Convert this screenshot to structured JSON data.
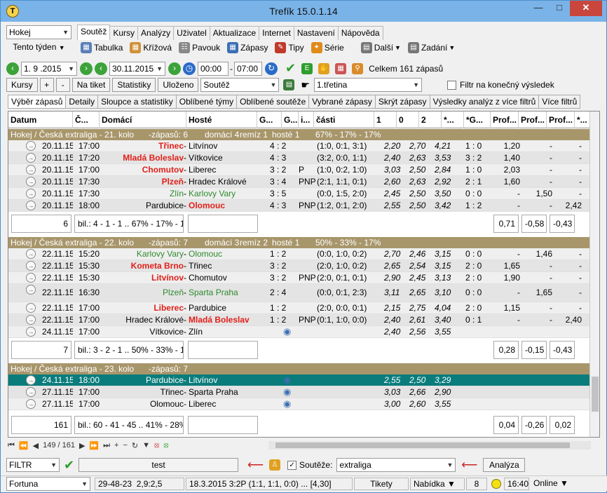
{
  "window": {
    "title": "Trefík 15.0.1.14"
  },
  "toolbar1": {
    "sport": "Hokej",
    "period": "Tento týden",
    "tabs": [
      "Soutěž",
      "Kursy",
      "Analýzy",
      "Uživatel",
      "Aktualizace",
      "Internet",
      "Nastavení",
      "Nápověda"
    ],
    "tools": [
      "Tabulka",
      "Křížová",
      "Pavouk",
      "Zápasy",
      "Tipy",
      "Série",
      "Další",
      "Zadání"
    ]
  },
  "toolbar2": {
    "date_from": "1. 9 .2015",
    "date_to": "30.11.2015",
    "time_from": "00:00",
    "time_to": "07:00",
    "total": "Celkem 161 zápasů"
  },
  "toolbar3": {
    "buttons": [
      "Kursy",
      "+",
      "-",
      "Na tiket",
      "Statistiky",
      "Uloženo"
    ],
    "filter_combo": "Soutěž",
    "period_combo": "1.třetina",
    "final_filter": "Filtr na konečný výsledek"
  },
  "subtabs": [
    "Výběr zápasů",
    "Detaily",
    "Sloupce a statistiky",
    "Oblíbené týmy",
    "Oblíbené soutěže",
    "Vybrané zápasy",
    "Skrýt zápasy",
    "Výsledky analýz z více filtrů",
    "Více filtrů"
  ],
  "columns": [
    "Datum",
    "Č...",
    "Domácí",
    "Hosté",
    "G...",
    "G...",
    "i...",
    "části",
    "1",
    "0",
    "2",
    "*...",
    "*G...",
    "Prof...",
    "Prof...",
    "Prof...",
    "*..."
  ],
  "groups": [
    {
      "title": "Hokej / Česká extraliga - 21. kolo",
      "count": "-zápasů: 6",
      "home": "domácí 4",
      "draw": "remíz 1",
      "away": "hosté 1",
      "pct": "67% - 17% - 17%",
      "rows": [
        {
          "date": "20.11.15",
          "time": "17:00",
          "home": "Třinec",
          "home_style": "red",
          "away": "Litvínov",
          "away_style": "",
          "score": "4 : 2",
          "extra": "",
          "parts": "(1:0, 0:1, 3:1)",
          "o1": "2,20",
          "o0": "2,70",
          "o2": "4,21",
          "res": "1 : 0",
          "p1": "1,20",
          "p2": "-",
          "p3": "-"
        },
        {
          "date": "20.11.15",
          "time": "17:20",
          "home": "Mladá Boleslav",
          "home_style": "red",
          "away": "Vítkovice",
          "away_style": "",
          "score": "4 : 3",
          "extra": "",
          "parts": "(3:2, 0:0, 1:1)",
          "o1": "2,40",
          "o0": "2,63",
          "o2": "3,53",
          "res": "3 : 2",
          "p1": "1,40",
          "p2": "-",
          "p3": "-"
        },
        {
          "date": "20.11.15",
          "time": "17:00",
          "home": "Chomutov",
          "home_style": "red",
          "away": "Liberec",
          "away_style": "",
          "score": "3 : 2",
          "extra": "P",
          "parts": "(1:0, 0:2, 1:0)",
          "o1": "3,03",
          "o0": "2,50",
          "o2": "2,84",
          "res": "1 : 0",
          "p1": "2,03",
          "p2": "-",
          "p3": "-"
        },
        {
          "date": "20.11.15",
          "time": "17:30",
          "home": "Plzeň",
          "home_style": "red",
          "away": "Hradec Králové",
          "away_style": "",
          "score": "3 : 4",
          "extra": "PNP",
          "parts": "(2:1, 1:1, 0:1)",
          "o1": "2,60",
          "o0": "2,63",
          "o2": "2,92",
          "res": "2 : 1",
          "p1": "1,60",
          "p2": "-",
          "p3": "-"
        },
        {
          "date": "20.11.15",
          "time": "17:30",
          "home": "Zlín",
          "home_style": "green",
          "away": "Karlovy Vary",
          "away_style": "green",
          "score": "3 : 5",
          "extra": "",
          "parts": "(0:0, 1:5, 2:0)",
          "o1": "2,45",
          "o0": "2,50",
          "o2": "3,50",
          "res": "0 : 0",
          "p1": "-",
          "p2": "1,50",
          "p3": "-"
        },
        {
          "date": "20.11.15",
          "time": "18:00",
          "home": "Pardubice",
          "home_style": "",
          "away": "Olomouc",
          "away_style": "red",
          "score": "4 : 3",
          "extra": "PNP",
          "parts": "(1:2, 0:1, 2:0)",
          "o1": "2,55",
          "o0": "2,50",
          "o2": "3,42",
          "res": "1 : 2",
          "p1": "-",
          "p2": "-",
          "p3": "2,42"
        }
      ],
      "summary": {
        "count": "6",
        "bil": "bil.: 4 - 1 - 1 .. 67% - 17% - 1",
        "v1": "0,71",
        "v2": "-0,58",
        "v3": "-0,43"
      }
    },
    {
      "title": "Hokej / Česká extraliga - 22. kolo",
      "count": "-zápasů: 7",
      "home": "domácí 3",
      "draw": "remíz 2",
      "away": "hosté 1",
      "pct": "50% - 33% - 17%",
      "rows": [
        {
          "date": "22.11.15",
          "time": "15:20",
          "home": "Karlovy Vary",
          "home_style": "green",
          "away": "Olomouc",
          "away_style": "green",
          "score": "1 : 2",
          "extra": "",
          "parts": "(0:0, 1:0, 0:2)",
          "o1": "2,70",
          "o0": "2,46",
          "o2": "3,15",
          "res": "0 : 0",
          "p1": "-",
          "p2": "1,46",
          "p3": "-"
        },
        {
          "date": "22.11.15",
          "time": "15:30",
          "home": "Kometa Brno",
          "home_style": "red",
          "away": "Třinec",
          "away_style": "",
          "score": "3 : 2",
          "extra": "",
          "parts": "(2:0, 1:0, 0:2)",
          "o1": "2,65",
          "o0": "2,54",
          "o2": "3,15",
          "res": "2 : 0",
          "p1": "1,65",
          "p2": "-",
          "p3": "-"
        },
        {
          "date": "22.11.15",
          "time": "15:30",
          "home": "Litvínov",
          "home_style": "red",
          "away": "Chomutov",
          "away_style": "",
          "score": "3 : 2",
          "extra": "PNP",
          "parts": "(2:0, 0:1, 0:1)",
          "o1": "2,90",
          "o0": "2,45",
          "o2": "3,13",
          "res": "2 : 0",
          "p1": "1,90",
          "p2": "-",
          "p3": "-"
        },
        {
          "date": "22.11.15",
          "time": "16:30",
          "home": "Plzeň",
          "home_style": "green",
          "away": "Sparta Praha",
          "away_style": "green",
          "score": "2 : 4",
          "extra": "",
          "parts": "(0:0, 0:1, 2:3)",
          "o1": "3,11",
          "o0": "2,65",
          "o2": "3,10",
          "res": "0 : 0",
          "p1": "-",
          "p2": "1,65",
          "p3": "-",
          "tall": true
        },
        {
          "date": "22.11.15",
          "time": "17:00",
          "home": "Liberec",
          "home_style": "red",
          "away": "Pardubice",
          "away_style": "",
          "score": "1 : 2",
          "extra": "",
          "parts": "(2:0, 0:0, 0:1)",
          "o1": "2,15",
          "o0": "2,75",
          "o2": "4,04",
          "res": "2 : 0",
          "p1": "1,15",
          "p2": "-",
          "p3": "-"
        },
        {
          "date": "22.11.15",
          "time": "17:00",
          "home": "Hradec Králové",
          "home_style": "",
          "away": "Mladá Boleslav",
          "away_style": "red",
          "score": "1 : 2",
          "extra": "PNP",
          "parts": "(0:1, 1:0, 0:0)",
          "o1": "2,40",
          "o0": "2,61",
          "o2": "3,40",
          "res": "0 : 1",
          "p1": "-",
          "p2": "-",
          "p3": "2,40"
        },
        {
          "date": "24.11.15",
          "time": "17:00",
          "home": "Vítkovice",
          "home_style": "",
          "away": "Zlín",
          "away_style": "",
          "score": "",
          "extra": "",
          "parts": "",
          "o1": "2,40",
          "o0": "2,56",
          "o2": "3,55",
          "res": "",
          "p1": "",
          "p2": "",
          "p3": "",
          "eye": true
        }
      ],
      "summary": {
        "count": "7",
        "bil": "bil.: 3 - 2 - 1 .. 50% - 33% - 1",
        "v1": "0,28",
        "v2": "-0,15",
        "v3": "-0,43"
      }
    },
    {
      "title": "Hokej / Česká extraliga - 23. kolo",
      "count": "-zápasů: 7",
      "home": "",
      "draw": "",
      "away": "",
      "pct": "",
      "rows": [
        {
          "date": "24.11.15",
          "time": "18:00",
          "home": "Pardubice",
          "home_style": "",
          "away": "Litvínov",
          "away_style": "",
          "score": "",
          "extra": "",
          "parts": "",
          "o1": "2,55",
          "o0": "2,50",
          "o2": "3,29",
          "res": "",
          "p1": "",
          "p2": "",
          "p3": "",
          "eye": true,
          "selected": true
        },
        {
          "date": "27.11.15",
          "time": "17:00",
          "home": "Třinec",
          "home_style": "",
          "away": "Sparta Praha",
          "away_style": "",
          "score": "",
          "extra": "",
          "parts": "",
          "o1": "3,03",
          "o0": "2,66",
          "o2": "2,90",
          "res": "",
          "p1": "",
          "p2": "",
          "p3": "",
          "eye": true
        },
        {
          "date": "27.11.15",
          "time": "17:00",
          "home": "Olomouc",
          "home_style": "",
          "away": "Liberec",
          "away_style": "",
          "score": "",
          "extra": "",
          "parts": "",
          "o1": "3,00",
          "o0": "2,60",
          "o2": "3,55",
          "res": "",
          "p1": "",
          "p2": "",
          "p3": "",
          "eye": true
        }
      ]
    }
  ],
  "total_summary": {
    "count": "161",
    "bil": "bil.: 60 - 41 - 45 .. 41% - 28%",
    "v1": "0,04",
    "v2": "-0,26",
    "v3": "0,02"
  },
  "grid_footer": {
    "position": "149 / 161"
  },
  "bottom": {
    "filter": "FILTR",
    "name": "test",
    "competition_label": "Soutěže:",
    "competition": "extraliga",
    "analyze": "Analýza"
  },
  "status": {
    "bookmaker": "Fortuna",
    "stat1": "29-48-23",
    "stat2": "2,9:2,5",
    "match": "18.3.2015 3:2P (1:1, 1:1, 0:0) ... [4,30]",
    "tikety": "Tikety",
    "nabidka": "Nabídka",
    "num": "8",
    "time": "16:40",
    "online": "Online"
  }
}
